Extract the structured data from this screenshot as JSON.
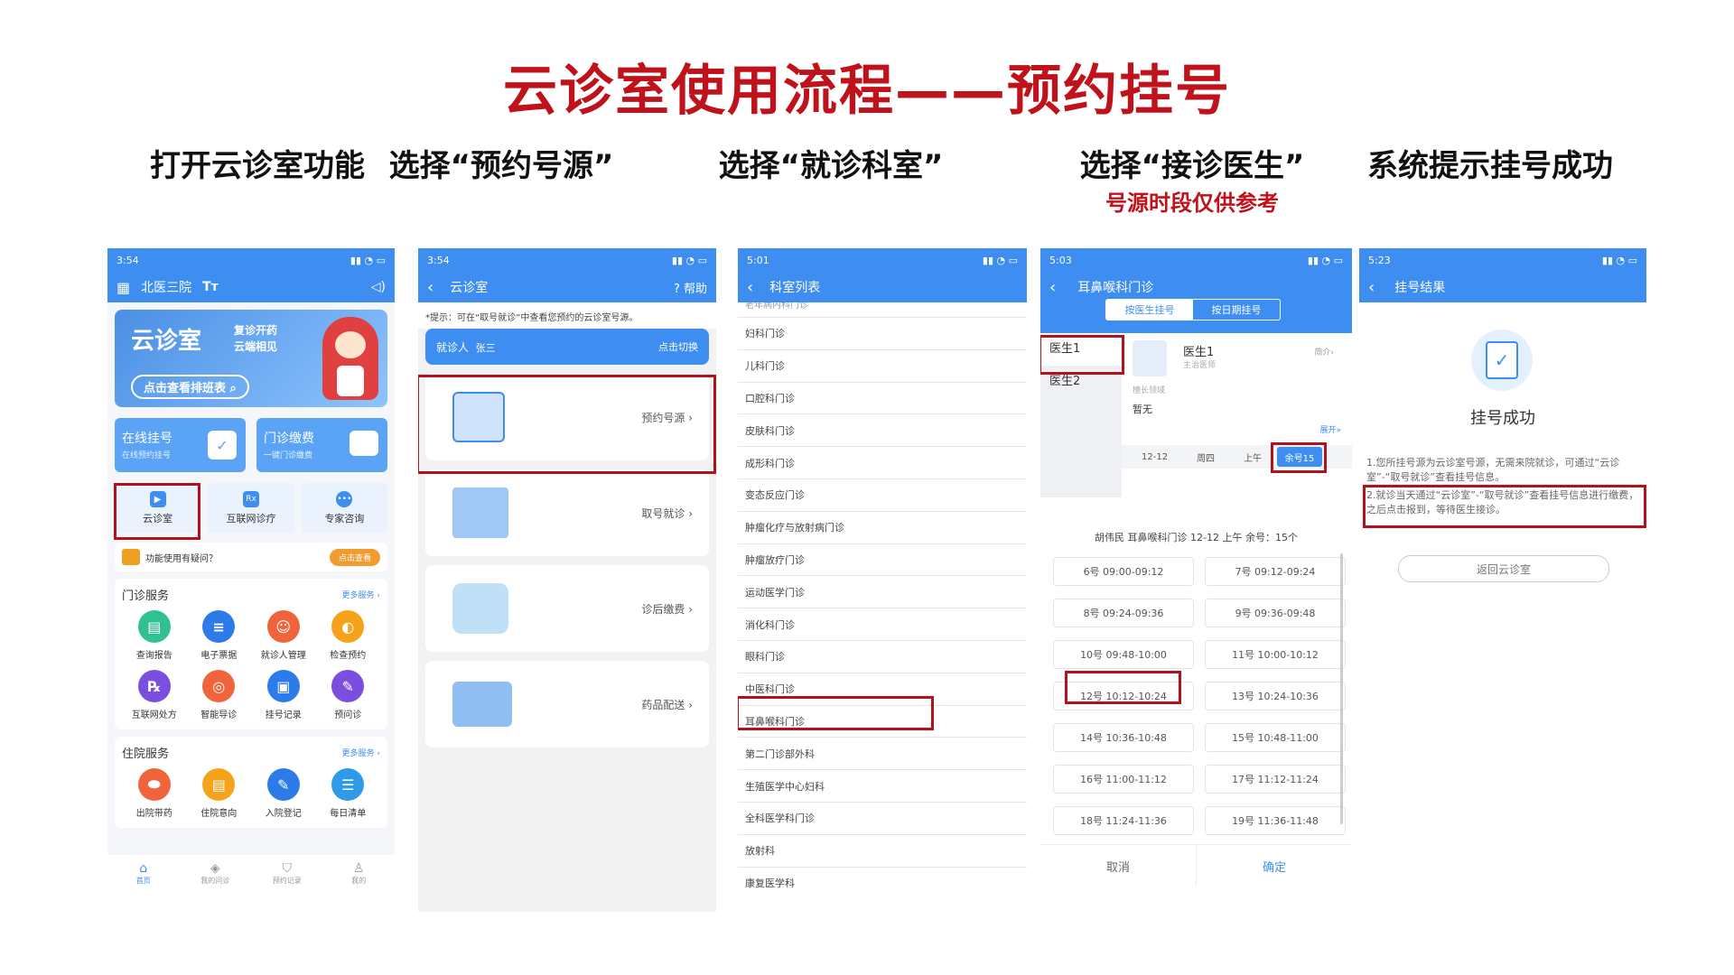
{
  "title": "云诊室使用流程——预约挂号",
  "steps": [
    {
      "title": "打开云诊室功能"
    },
    {
      "title": "选择“预约号源”"
    },
    {
      "title": "选择“就诊科室”",
      "note": ""
    },
    {
      "title": "选择“接诊医生”",
      "note": "号源时段仅供参考"
    },
    {
      "title": "系统提示挂号成功"
    }
  ],
  "phone1": {
    "time": "3:54",
    "location": "北医三院",
    "banner_title": "云诊室",
    "banner_slogan1": "复诊开药",
    "banner_slogan2": "云端相见",
    "banner_button": "点击查看排班表",
    "card1_title": "在线挂号",
    "card1_sub": "在线预约挂号",
    "card2_title": "门诊缴费",
    "card2_sub": "一键门诊缴费",
    "quick": [
      "云诊室",
      "互联网诊疗",
      "专家咨询"
    ],
    "help_text": "功能使用有疑问？",
    "help_button": "点击查看",
    "outpatient_title": "门诊服务",
    "more": "更多服务 ›",
    "outpatient_items": [
      "查询报告",
      "电子票据",
      "就诊人管理",
      "检查预约",
      "互联网处方",
      "智能导诊",
      "挂号记录",
      "预问诊"
    ],
    "inpatient_title": "住院服务",
    "inpatient_items": [
      "出院带药",
      "住院意向",
      "入院登记",
      "每日清单"
    ],
    "tabs": [
      "首页",
      "我的问诊",
      "预约记录",
      "我的"
    ]
  },
  "phone2": {
    "time": "3:54",
    "nav_title": "云诊室",
    "help": "帮助",
    "tip": "*提示：可在“取号就诊”中查看您预约的云诊室号源。",
    "patient_label": "就诊人",
    "patient_name": "张三",
    "switch": "点击切换",
    "rows": [
      "预约号源",
      "取号就诊",
      "诊后缴费",
      "药品配送"
    ]
  },
  "phone3": {
    "time": "5:01",
    "nav_title": "科室列表",
    "partial_row": "老年病内科门诊",
    "departments": [
      "妇科门诊",
      "儿科门诊",
      "口腔科门诊",
      "皮肤科门诊",
      "成形科门诊",
      "变态反应门诊",
      "肿瘤化疗与放射病门诊",
      "肿瘤放疗门诊",
      "运动医学门诊",
      "消化科门诊",
      "眼科门诊",
      "中医科门诊",
      "耳鼻喉科门诊",
      "第二门诊部外科",
      "生殖医学中心妇科",
      "全科医学科门诊",
      "放射科",
      "康复医学科"
    ]
  },
  "phone4": {
    "time": "5:03",
    "nav_title": "耳鼻喉科门诊",
    "seg_active": "按医生挂号",
    "seg_other": "按日期挂号",
    "doctors": [
      "医生1",
      "医生2"
    ],
    "doctor_name": "医生1",
    "doctor_title": "主治医师",
    "intro": "简介›",
    "specialty_label": "擅长领域",
    "specialty_value": "暂无",
    "expand": "展开»",
    "date": "12-12",
    "weekday": "周四",
    "period": "上午",
    "remaining_badge": "余号15",
    "summary": "胡伟民  耳鼻喉科门诊  12-12  上午    余号：15个",
    "slots": [
      "6号  09:00-09:12",
      "7号  09:12-09:24",
      "8号  09:24-09:36",
      "9号  09:36-09:48",
      "10号  09:48-10:00",
      "11号  10:00-10:12",
      "12号  10:12-10:24",
      "13号  10:24-10:36",
      "14号  10:36-10:48",
      "15号  10:48-11:00",
      "16号  11:00-11:12",
      "17号  11:12-11:24",
      "18号  11:24-11:36",
      "19号  11:36-11:48"
    ],
    "cancel": "取消",
    "confirm": "确定"
  },
  "phone5": {
    "time": "5:23",
    "nav_title": "挂号结果",
    "success": "挂号成功",
    "note1": "1.您所挂号源为云诊室号源，无需来院就诊，可通过“云诊室”-“取号就诊”查看挂号信息。",
    "note2": "2.就诊当天通过“云诊室”-“取号就诊”查看挂号信息进行缴费，之后点击报到，等待医生接诊。",
    "back_button": "返回云诊室"
  }
}
